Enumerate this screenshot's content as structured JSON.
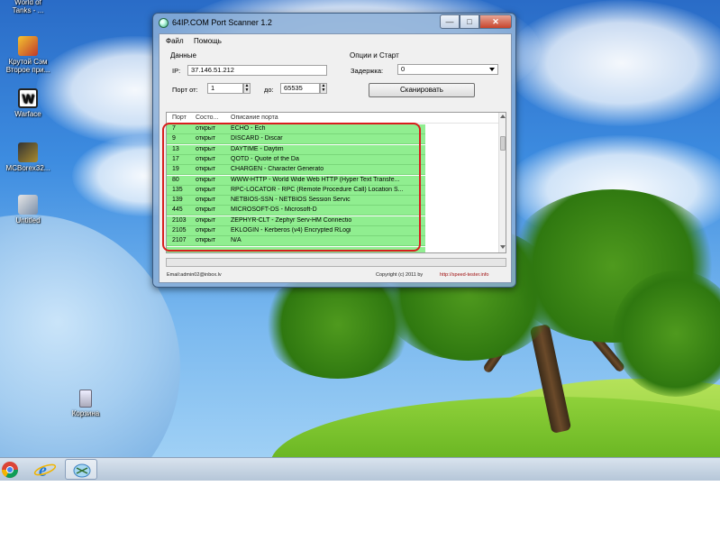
{
  "desktop": {
    "icons": [
      {
        "label": "World of\nTanks - ..."
      },
      {
        "label": "Крутой Сэм\nВторое при..."
      },
      {
        "label": "Warface"
      },
      {
        "label": "MCBorex32..."
      },
      {
        "label": "Untitled"
      },
      {
        "label": "Корзина"
      }
    ]
  },
  "window": {
    "title": "64IP.COM Port Scanner 1.2",
    "controls": {
      "minimize": "—",
      "maximize": "□",
      "close": "✕"
    },
    "menu": [
      "Файл",
      "Помощь"
    ],
    "data_group": {
      "title": "Данные",
      "ip_label": "IP:",
      "ip_value": "37.146.51.212",
      "port_from_label": "Порт от:",
      "port_from_value": "1",
      "port_to_label": "до:",
      "port_to_value": "65535"
    },
    "options_group": {
      "title": "Опции и Старт",
      "delay_label": "Задержка:",
      "delay_value": "0",
      "scan_button": "Сканировать"
    },
    "list": {
      "columns": [
        "Порт",
        "Состо...",
        "Описание порта"
      ],
      "rows": [
        {
          "port": "7",
          "state": "открыт",
          "description": "ECHO - Ech"
        },
        {
          "port": "9",
          "state": "открыт",
          "description": "DISCARD - Discar"
        },
        {
          "port": "13",
          "state": "открыт",
          "description": "DAYTIME - Daytim"
        },
        {
          "port": "17",
          "state": "открыт",
          "description": "QOTD - Quote of the Da"
        },
        {
          "port": "19",
          "state": "открыт",
          "description": "CHARGEN - Character Generato"
        },
        {
          "port": "80",
          "state": "открыт",
          "description": "WWW-HTTP - World Wide Web HTTP (Hyper Text Transfe..."
        },
        {
          "port": "135",
          "state": "открыт",
          "description": "RPC-LOCATOR - RPC (Remote Procedure Call) Location S..."
        },
        {
          "port": "139",
          "state": "открыт",
          "description": "NETBIOS-SSN - NETBIOS Session Servic"
        },
        {
          "port": "445",
          "state": "открыт",
          "description": "MICROSOFT-DS - Microsoft-D"
        },
        {
          "port": "2103",
          "state": "открыт",
          "description": "ZEPHYR-CLT - Zephyr Serv-HM Connectio"
        },
        {
          "port": "2105",
          "state": "открыт",
          "description": "EKLOGIN - Kerberos (v4) Encrypted RLogi"
        },
        {
          "port": "2107",
          "state": "открыт",
          "description": "N/A"
        },
        {
          "port": "",
          "state": "",
          "description": ""
        }
      ]
    },
    "status": {
      "email": "Email:admin02@inbox.lv",
      "copyright": "Copyright (c) 2011 by",
      "url": "http://speed-tester.info"
    }
  },
  "colors": {
    "row_highlight": "#90ee90",
    "annotation_box": "#d81e1e",
    "status_url": "#a01010"
  }
}
